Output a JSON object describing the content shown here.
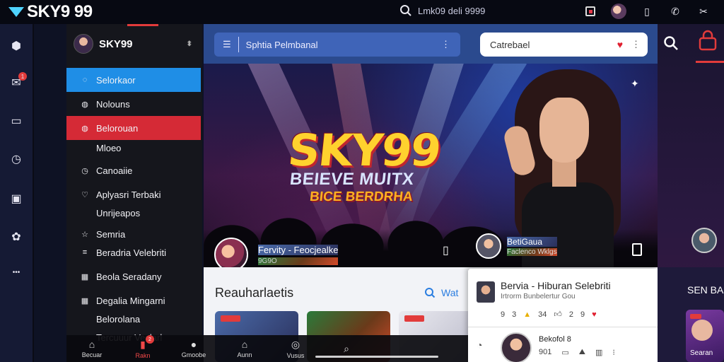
{
  "header": {
    "logo_text": "SKY9 99",
    "search_text": "Lmk09 deli 9999"
  },
  "menu": {
    "profile_name": "SKY99",
    "items": [
      {
        "label": "Selorkaor",
        "icon": "chat-icon",
        "state": "active-blue"
      },
      {
        "label": "Nolouns",
        "icon": "bubble-icon",
        "state": ""
      },
      {
        "label": "Belorouan",
        "icon": "bubble-icon",
        "state": "active-red"
      },
      {
        "label": "Mloeo",
        "icon": "",
        "state": "sub"
      },
      {
        "label": "Canoaiie",
        "icon": "clock-icon",
        "state": ""
      },
      {
        "label": "Aplyasri Terbaki",
        "icon": "heart-icon",
        "state": ""
      },
      {
        "label": "Unrijeapos",
        "icon": "",
        "state": "sub"
      },
      {
        "label": "Semria",
        "icon": "star-icon",
        "state": ""
      },
      {
        "label": "Beradria Velebriti",
        "icon": "bars-icon",
        "state": ""
      },
      {
        "label": "Beola Seradany",
        "icon": "grid-icon",
        "state": ""
      },
      {
        "label": "Degalia Mingarni",
        "icon": "grid-icon",
        "state": ""
      },
      {
        "label": "Belorolana",
        "icon": "",
        "state": "sub"
      },
      {
        "label": "Tercuuur Veslarl",
        "icon": "",
        "state": "sub"
      }
    ]
  },
  "mainbar": {
    "left_pill": "Sphtia Pelmbanal",
    "right_pill": "Catrebael"
  },
  "hero": {
    "logo": "SKY99",
    "sub1": "BEIEVE MUITX",
    "sub2": "BICE BERDRHA",
    "left_title": "Fervity - Feocjealke",
    "left_sub": "9G9O",
    "right_title": "BetiGaua",
    "right_sub": "Faclenco Wklgs"
  },
  "lower": {
    "section_title": "Reauharlaetis",
    "action_label": "Wat"
  },
  "card": {
    "title": "Bervia - Hiburan Selebriti",
    "subtitle": "Irtrorm Bunbelertur Gou",
    "stats": [
      "9",
      "3",
      "34",
      "2",
      "9"
    ],
    "name": "Bekofol 8",
    "meta": [
      "901",
      "",
      "",
      ""
    ]
  },
  "bottombar": {
    "items": [
      "Becuar",
      "Rakn",
      "Gmoobe",
      "Aunn",
      "Vusus"
    ],
    "badge": "2"
  },
  "rightpanel": {
    "label": "SEN BA",
    "card_label": "Searan"
  }
}
